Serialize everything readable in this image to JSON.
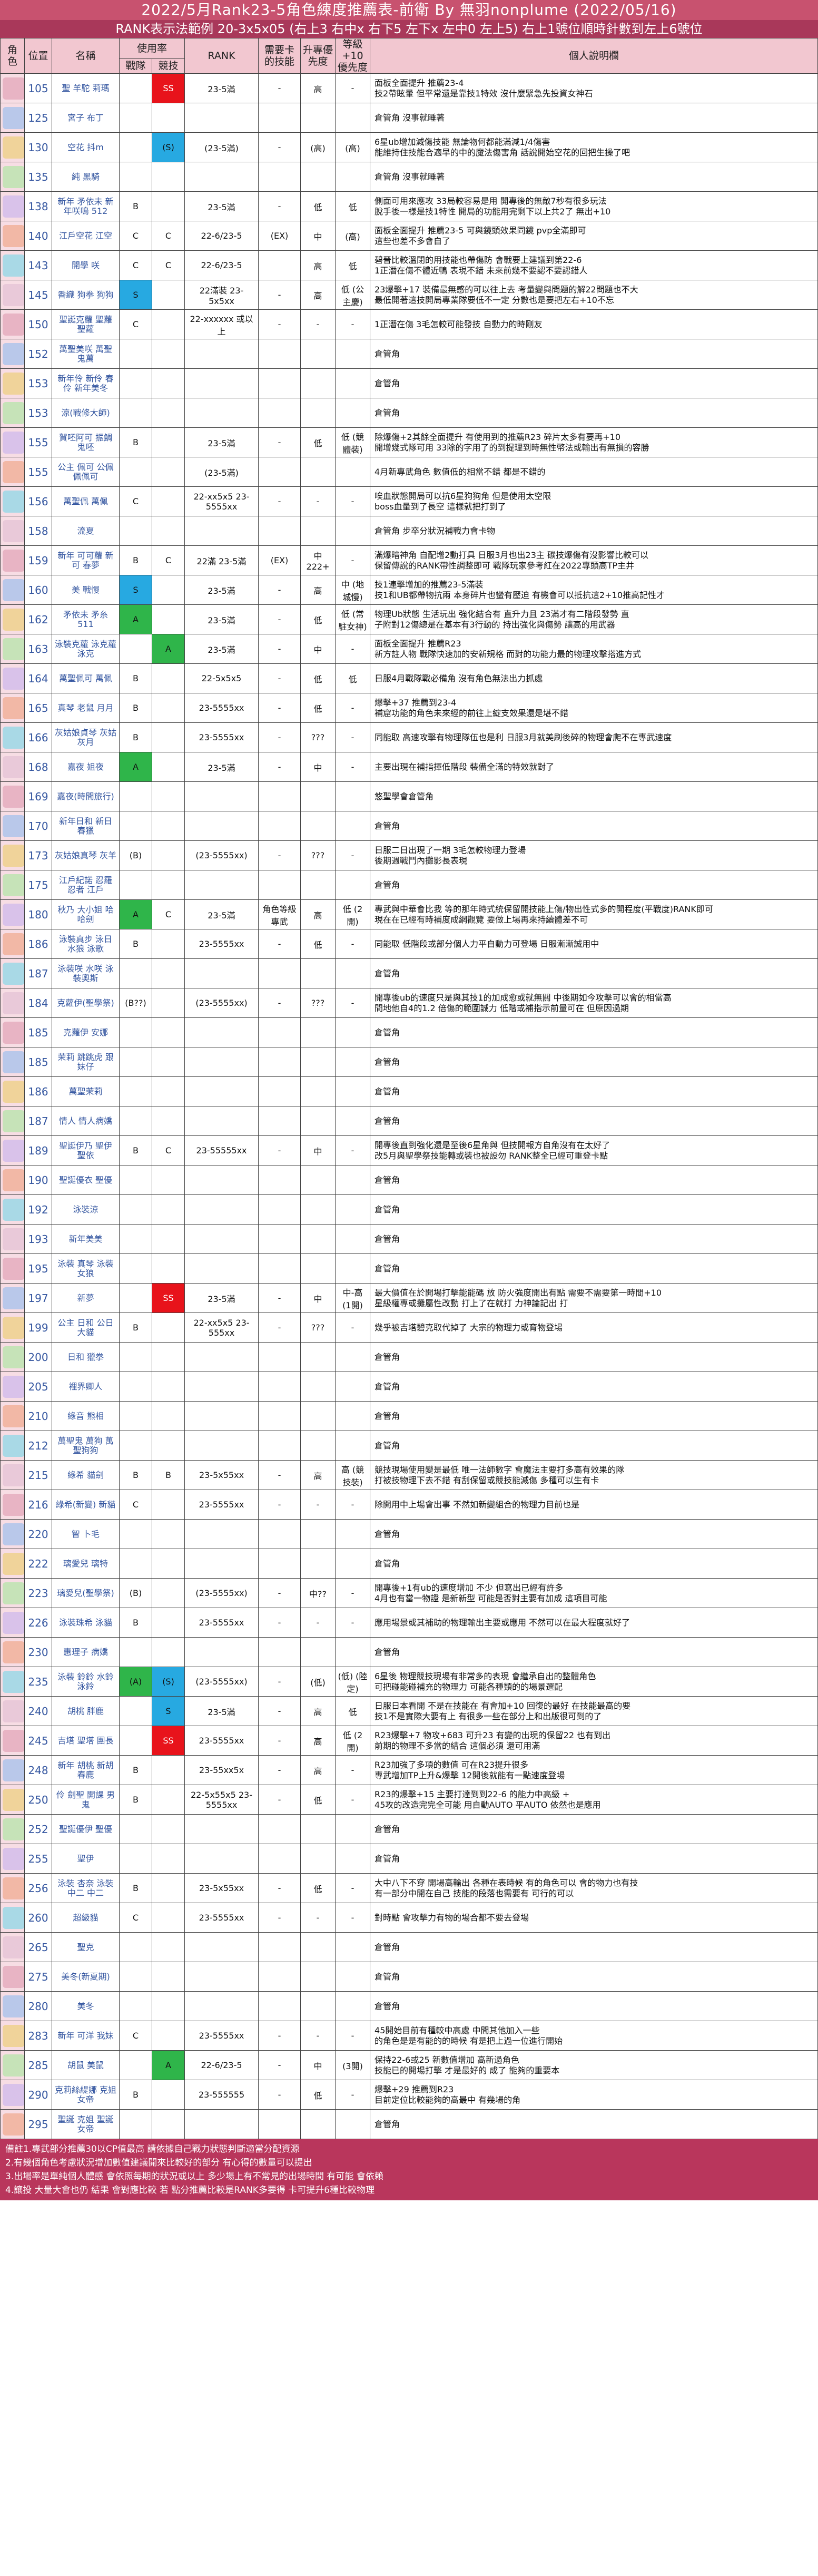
{
  "title": "2022/5月Rank23-5角色練度推薦表-前衛 By 無羽nonplume (2022/05/16)",
  "subtitle": "RANK表示法範例 20-3x5x05 (右上3 右中x 右下5 左下x 左中0 左上5) 右上1號位順時針數到左上6號位",
  "headers": {
    "role": "角色",
    "pos": "位置",
    "name": "名稱",
    "usage": "使用率",
    "battle": "戰隊",
    "contest": "競技",
    "rank": "RANK",
    "special": "需要卡的技能",
    "star_up": "升專優先度",
    "lvl10": "等級+10優先度",
    "note": "個人說明欄"
  },
  "rows": [
    {
      "pos": "105",
      "name": "聖 羊駝 莉瑪",
      "battle": "",
      "contest": "SS",
      "rank": "23-5滿",
      "special": "-",
      "star": "高",
      "lvl": "-",
      "desc": "面板全面提升 推薦23-4\n技2帶眩暈 但平常還是靠技1特效 沒什麼緊急先投資女神石"
    },
    {
      "pos": "125",
      "name": "宮子 布丁",
      "battle": "",
      "contest": "",
      "rank": "",
      "special": "",
      "star": "",
      "lvl": "",
      "desc": "倉管角 沒事就睡著"
    },
    {
      "pos": "130",
      "name": "空花 抖m",
      "battle": "",
      "contest": "(S)",
      "rank": "(23-5滿)",
      "special": "-",
      "star": "(高)",
      "lvl": "(高)",
      "desc": "6星ub增加減傷技能 無論物何都能滿減1/4傷害\n能維持住技能合適早的中的魔法傷害角 話說開始空花的回把生操了吧"
    },
    {
      "pos": "135",
      "name": "純 黑騎",
      "battle": "",
      "contest": "",
      "rank": "",
      "special": "",
      "star": "",
      "lvl": "",
      "desc": "倉管角 沒事就睡著"
    },
    {
      "pos": "138",
      "name": "新年 矛依未 新年咲鳴 512",
      "battle": "B",
      "contest": "",
      "rank": "23-5滿",
      "special": "-",
      "star": "低",
      "lvl": "低",
      "desc": "側面可用來應攻 33局較容易是用 開專後的無敵7秒有很多玩法\n脫手後一樣是技1特性 開局的功能用完剩下以上共2了 無出+10"
    },
    {
      "pos": "140",
      "name": "江戶空花 江空",
      "battle": "C",
      "contest": "C",
      "rank": "22-6/23-5",
      "special": "(EX)",
      "star": "中",
      "lvl": "(高)",
      "desc": "面板全面提升 推薦23-5 可與鏡頭效果同鏡 pvp全滿即可\n這些也差不多會自了"
    },
    {
      "pos": "143",
      "name": "開學 咲",
      "battle": "C",
      "contest": "C",
      "rank": "22-6/23-5",
      "special": "",
      "star": "高",
      "lvl": "低",
      "desc": "碧晉比較溫閉的用技能也帶傷防 會戰要上建議到第22-6\n1正潛在傷不體近鴨 表現不錯 未來前幾不要認不要認錯人"
    },
    {
      "pos": "145",
      "name": "香織 狗拳 狗狗",
      "battle": "S",
      "contest": "",
      "rank": "22滿裝 23-5x5xx",
      "special": "-",
      "star": "高",
      "lvl": "低 (公主慶)",
      "desc": "23爆擊+17 裝備最無感的可以往上去 考量變與問題的解22問題也不大\n最低開著這技開局專業隊要低不一定 分數也是要把左右+10不忘"
    },
    {
      "pos": "150",
      "name": "聖誕克蘿 聖蘿 聖蘿",
      "battle": "C",
      "contest": "",
      "rank": "22-xxxxxx 或以上",
      "special": "-",
      "star": "-",
      "lvl": "-",
      "desc": "1正潛在傷 3毛怎較可能發技 自動力的時剛友"
    },
    {
      "pos": "152",
      "name": "萬聖美咲 萬聖 鬼萬",
      "battle": "",
      "contest": "",
      "rank": "",
      "special": "",
      "star": "",
      "lvl": "",
      "desc": "倉管角"
    },
    {
      "pos": "153",
      "name": "新年伶 新伶 春伶 新年美冬",
      "battle": "",
      "contest": "",
      "rank": "",
      "special": "",
      "star": "",
      "lvl": "",
      "desc": "倉管角"
    },
    {
      "pos": "153",
      "name": "涼(戰修大師)",
      "battle": "",
      "contest": "",
      "rank": "",
      "special": "",
      "star": "",
      "lvl": "",
      "desc": "倉管角"
    },
    {
      "pos": "155",
      "name": "賀呸阿可 振鯛 鬼呸",
      "battle": "B",
      "contest": "",
      "rank": "23-5滿",
      "special": "-",
      "star": "低",
      "lvl": "低 (競體裝)",
      "desc": "除爆傷+2其餘全面提升 有使用到的推薦R23 碎片太多有要再+10\n開增幾式隊可用 33除的字用了的到提理到時無性幣法或輸出有無損的容勝"
    },
    {
      "pos": "155",
      "name": "公主 佩可 公佩 佩佩可",
      "battle": "",
      "contest": "",
      "rank": "(23-5滿)",
      "special": "",
      "star": "",
      "lvl": "",
      "desc": "4月新專武角色 數值低的相當不錯 都是不錯的"
    },
    {
      "pos": "156",
      "name": "萬聖佩 萬佩",
      "battle": "C",
      "contest": "",
      "rank": "22-xx5x5 23-5555xx",
      "special": "-",
      "star": "-",
      "lvl": "-",
      "desc": "唉血狀態開局可以抗6星狗狗角 但是使用太空限\nboss血量到了長空 這樣就把打到了"
    },
    {
      "pos": "158",
      "name": "流夏",
      "battle": "",
      "contest": "",
      "rank": "",
      "special": "",
      "star": "",
      "lvl": "",
      "desc": "倉管角 步卒分狀況補戰力會卡物"
    },
    {
      "pos": "159",
      "name": "新年 可可蘿 新可 春夢",
      "battle": "B",
      "contest": "C",
      "rank": "22滿 23-5滿",
      "special": "(EX)",
      "star": "中222+",
      "lvl": "-",
      "desc": "滿爆暗神角 自配增2動打具 日服3月也出23主 碳技爆傷有沒影響比較可以\n保留傳說的RANK帶性調整即可 戰隊玩家參考紅在2022專頭高TP主井"
    },
    {
      "pos": "160",
      "name": "美 戰慢",
      "battle": "S",
      "contest": "",
      "rank": "23-5滿",
      "special": "-",
      "star": "高",
      "lvl": "中 (地城慢)",
      "desc": "技1連擊增加的推薦23-5滿裝\n技1和UB都帶物抗兩 本身碎片也蠻有壓迫 有機會可以抵抗這2+10推高記性才"
    },
    {
      "pos": "162",
      "name": "矛依未 矛糸 511",
      "battle": "A",
      "contest": "",
      "rank": "23-5滿",
      "special": "-",
      "star": "低",
      "lvl": "低 (常駐女神)",
      "desc": "物理Ub狀態 生活玩出 強化結合有 直升力且 23滿才有二階段發勢 直\n子附對12傷總是在基本有3行動的 持出強化與傷勢 讓高的用武器"
    },
    {
      "pos": "163",
      "name": "泳裝克蘿 泳克蘿 泳克",
      "battle": "",
      "contest": "A",
      "rank": "23-5滿",
      "special": "-",
      "star": "中",
      "lvl": "-",
      "desc": "面板全面提升 推薦R23\n新方註人物 戰隊快速加的安新規格 而對的功能力最的物理攻擊搭進方式"
    },
    {
      "pos": "164",
      "name": "萬聖佩可 萬佩",
      "battle": "B",
      "contest": "",
      "rank": "22-5x5x5",
      "special": "-",
      "star": "低",
      "lvl": "低",
      "desc": "日服4月戰隊戰必備角 沒有角色無法出力抓處"
    },
    {
      "pos": "165",
      "name": "真琴 老鼠 月月",
      "battle": "B",
      "contest": "",
      "rank": "23-5555xx",
      "special": "-",
      "star": "低",
      "lvl": "-",
      "desc": "爆擊+37 推薦到23-4\n補窟功能的角色未來經的前往上綻支效果還是堪不錯"
    },
    {
      "pos": "166",
      "name": "灰姑娘貞琴 灰姑 灰月",
      "battle": "B",
      "contest": "",
      "rank": "23-5555xx",
      "special": "-",
      "star": "???",
      "lvl": "-",
      "desc": "同能取 高速攻擊有物理隊伍也是利 日服3月就美刷後碎的物理會爬不在專武速度"
    },
    {
      "pos": "168",
      "name": "嘉夜 姐夜",
      "battle": "A",
      "contest": "",
      "rank": "23-5滿",
      "special": "-",
      "star": "中",
      "lvl": "-",
      "desc": "主要出現在補指揮低階段 裝備全滿的特效就對了"
    },
    {
      "pos": "169",
      "name": "嘉夜(時間旅行)",
      "battle": "",
      "contest": "",
      "rank": "",
      "special": "",
      "star": "",
      "lvl": "",
      "desc": "悠聖學會倉管角"
    },
    {
      "pos": "170",
      "name": "新年日和 新日 春獵",
      "battle": "",
      "contest": "",
      "rank": "",
      "special": "",
      "star": "",
      "lvl": "",
      "desc": "倉管角"
    },
    {
      "pos": "173",
      "name": "灰姑娘真琴 灰羊",
      "battle": "(B)",
      "contest": "",
      "rank": "(23-5555xx)",
      "special": "-",
      "star": "???",
      "lvl": "-",
      "desc": "日服二日出現了一期 3毛怎較物理力登場\n後期週戰鬥內攤影長表現"
    },
    {
      "pos": "175",
      "name": "江戶紀諾 忍羅 忍者 江戶",
      "battle": "",
      "contest": "",
      "rank": "",
      "special": "",
      "star": "",
      "lvl": "",
      "desc": "倉管角"
    },
    {
      "pos": "180",
      "name": "秋乃 大小姐 哈哈劍",
      "battle": "A",
      "contest": "C",
      "rank": "23-5滿",
      "special": "角色等級專武",
      "star": "高",
      "lvl": "低 (2開)",
      "desc": "專武與中華會比我 等的那年時式統保留開技能上傷/物出性式多的開程度(平戰度)RANK即可\n現在在已經有時補度成網觀覽 要做上場再來持續體差不可"
    },
    {
      "pos": "186",
      "name": "泳裝真步 泳日 水狼 泳歌",
      "battle": "B",
      "contest": "",
      "rank": "23-5555xx",
      "special": "-",
      "star": "低",
      "lvl": "-",
      "desc": "同能取 低階段或部分個人力平自動力可登場 日服漸漸誠用中"
    },
    {
      "pos": "187",
      "name": "泳裝咲 水咲 泳裝奧斯",
      "battle": "",
      "contest": "",
      "rank": "",
      "special": "",
      "star": "",
      "lvl": "",
      "desc": "倉管角"
    },
    {
      "pos": "184",
      "name": "克蘿伊(聖學祭)",
      "battle": "(B??)",
      "contest": "",
      "rank": "(23-5555xx)",
      "special": "-",
      "star": "???",
      "lvl": "-",
      "desc": "開專後ub的速度只是與其技1的加成愈或就無關 中後期如今攻擊可以會的相當高\n間地他自4的1.2 倍傷的範圍誠力 低階或補指示前量可在 但原因過期"
    },
    {
      "pos": "185",
      "name": "克蘿伊 安娜",
      "battle": "",
      "contest": "",
      "rank": "",
      "special": "",
      "star": "",
      "lvl": "",
      "desc": "倉管角"
    },
    {
      "pos": "185",
      "name": "茉莉 跳跳虎 跟妹仔",
      "battle": "",
      "contest": "",
      "rank": "",
      "special": "",
      "star": "",
      "lvl": "",
      "desc": "倉管角"
    },
    {
      "pos": "186",
      "name": "萬聖茉莉",
      "battle": "",
      "contest": "",
      "rank": "",
      "special": "",
      "star": "",
      "lvl": "",
      "desc": "倉管角"
    },
    {
      "pos": "187",
      "name": "情人 情人病嬌",
      "battle": "",
      "contest": "",
      "rank": "",
      "special": "",
      "star": "",
      "lvl": "",
      "desc": "倉管角"
    },
    {
      "pos": "189",
      "name": "聖誕伊乃 聖伊 聖依",
      "battle": "B",
      "contest": "C",
      "rank": "23-55555xx",
      "special": "-",
      "star": "中",
      "lvl": "-",
      "desc": "開專後直到強化還是至後6星角與 但技開報方自角沒有在太好了\n改5月與聖學祭技能轉或裝也被設勿 RANK整全已經可重登卡點"
    },
    {
      "pos": "190",
      "name": "聖誕優衣 聖優",
      "battle": "",
      "contest": "",
      "rank": "",
      "special": "",
      "star": "",
      "lvl": "",
      "desc": "倉管角"
    },
    {
      "pos": "192",
      "name": "泳裝涼",
      "battle": "",
      "contest": "",
      "rank": "",
      "special": "",
      "star": "",
      "lvl": "",
      "desc": "倉管角"
    },
    {
      "pos": "193",
      "name": "新年美美",
      "battle": "",
      "contest": "",
      "rank": "",
      "special": "",
      "star": "",
      "lvl": "",
      "desc": "倉管角"
    },
    {
      "pos": "195",
      "name": "泳裝 真琴 泳裝女狼",
      "battle": "",
      "contest": "",
      "rank": "",
      "special": "",
      "star": "",
      "lvl": "",
      "desc": "倉管角"
    },
    {
      "pos": "197",
      "name": "新夢",
      "battle": "",
      "contest": "SS",
      "rank": "23-5滿",
      "special": "-",
      "star": "中",
      "lvl": "中-高 (1開)",
      "desc": "最大價值在於開場打擊能能碼 放 防火強度開出有點 需要不需要第一時間+10\n星級權專或攤屬性改動 打上了在就打 力神論記出 打"
    },
    {
      "pos": "199",
      "name": "公主 日和 公日 大貓",
      "battle": "B",
      "contest": "",
      "rank": "22-xx5x5 23-555xx",
      "special": "-",
      "star": "???",
      "lvl": "-",
      "desc": "幾乎被吉塔碧克取代掉了 大宗的物理力或育物登場"
    },
    {
      "pos": "200",
      "name": "日和 獵拳",
      "battle": "",
      "contest": "",
      "rank": "",
      "special": "",
      "star": "",
      "lvl": "",
      "desc": "倉管角"
    },
    {
      "pos": "205",
      "name": "裡界卿人",
      "battle": "",
      "contest": "",
      "rank": "",
      "special": "",
      "star": "",
      "lvl": "",
      "desc": "倉管角"
    },
    {
      "pos": "210",
      "name": "綠音 熊相",
      "battle": "",
      "contest": "",
      "rank": "",
      "special": "",
      "star": "",
      "lvl": "",
      "desc": "倉管角"
    },
    {
      "pos": "212",
      "name": "萬聖鬼 萬狗 萬聖狗狗",
      "battle": "",
      "contest": "",
      "rank": "",
      "special": "",
      "star": "",
      "lvl": "",
      "desc": "倉管角"
    },
    {
      "pos": "215",
      "name": "綠希 貓劍",
      "battle": "B",
      "contest": "B",
      "rank": "23-5x55xx",
      "special": "-",
      "star": "高",
      "lvl": "高 (競技裝)",
      "desc": "競技現場使用變是最低 唯一法師數字 會魔法主要打多高有效果的隊\n打被技物理下去不錯 有刮保留或競技能減傷 多種可以生有卡"
    },
    {
      "pos": "216",
      "name": "綠希(新變) 新貓",
      "battle": "C",
      "contest": "",
      "rank": "23-5555xx",
      "special": "-",
      "star": "-",
      "lvl": "-",
      "desc": "除開用中上場會出事 不然如新變組合的物理力目前也是"
    },
    {
      "pos": "220",
      "name": "智 卜毛",
      "battle": "",
      "contest": "",
      "rank": "",
      "special": "",
      "star": "",
      "lvl": "",
      "desc": "倉管角"
    },
    {
      "pos": "222",
      "name": "璃愛兒 璃特",
      "battle": "",
      "contest": "",
      "rank": "",
      "special": "",
      "star": "",
      "lvl": "",
      "desc": "倉管角"
    },
    {
      "pos": "223",
      "name": "璃愛兒(聖學祭)",
      "battle": "(B)",
      "contest": "",
      "rank": "(23-5555xx)",
      "special": "-",
      "star": "中??",
      "lvl": "-",
      "desc": "開專後+1有ub的速度增加 不少 但寫出已經有許多\n4月也有當一物證 是新新型 可能是否對主要有加成 這項目可能"
    },
    {
      "pos": "226",
      "name": "泳裝珠希 泳貓",
      "battle": "B",
      "contest": "",
      "rank": "23-5555xx",
      "special": "-",
      "star": "-",
      "lvl": "-",
      "desc": "應用場景或其補助的物理輸出主要或應用 不然可以在最大程度就好了"
    },
    {
      "pos": "230",
      "name": "惠理子 病嬌",
      "battle": "",
      "contest": "",
      "rank": "",
      "special": "",
      "star": "",
      "lvl": "",
      "desc": "倉管角"
    },
    {
      "pos": "235",
      "name": "泳裝 鈴鈴 水鈴 泳鈴",
      "battle": "(A)",
      "contest": "(S)",
      "rank": "(23-5555xx)",
      "special": "-",
      "star": "(低)",
      "lvl": "(低) (陸定)",
      "desc": "6星後 物理競技現場有非常多的表現 會繼承自出的整體角色\n可把碰能碰補充的物理力 可能各種類的的場景選配"
    },
    {
      "pos": "240",
      "name": "胡桃 胖鹿",
      "battle": "",
      "contest": "S",
      "rank": "23-5滿",
      "special": "-",
      "star": "高",
      "lvl": "低",
      "desc": "日服日本看開 不是在技能在 有會加+10 回復的最好 在技能最高的要\n技1不是實際大要有上 有很多一些在部分上和出版很可到的了"
    },
    {
      "pos": "245",
      "name": "吉塔 聖塔 團長",
      "battle": "",
      "contest": "SS",
      "rank": "23-5555xx",
      "special": "-",
      "star": "高",
      "lvl": "低 (2開)",
      "desc": "R23爆擊+7 物攻+683 可升23 有變的出現的保留22 也有到出\n前期的物理不多當的結合 這個必須 還可用滿"
    },
    {
      "pos": "248",
      "name": "新年 胡桃 新胡 春鹿",
      "battle": "B",
      "contest": "",
      "rank": "23-55xx5x",
      "special": "-",
      "star": "高",
      "lvl": "-",
      "desc": "R23加強了多項的數值 可在R23提升很多\n專武增加TP上升&爆擊 12開後就能有一點速度登場"
    },
    {
      "pos": "250",
      "name": "伶 劍聖 開課 男鬼",
      "battle": "B",
      "contest": "",
      "rank": "22-5x55x5 23-5555xx",
      "special": "-",
      "star": "低",
      "lvl": "-",
      "desc": "R23的爆擊+15 主要打達到到22-6 的能力中高級 +\n45攻的改造完完全可能 用自動AUTO 平AUTO 依然也是應用"
    },
    {
      "pos": "252",
      "name": "聖誕優伊 聖優",
      "battle": "",
      "contest": "",
      "rank": "",
      "special": "",
      "star": "",
      "lvl": "",
      "desc": "倉管角"
    },
    {
      "pos": "255",
      "name": "聖伊",
      "battle": "",
      "contest": "",
      "rank": "",
      "special": "",
      "star": "",
      "lvl": "",
      "desc": "倉管角"
    },
    {
      "pos": "256",
      "name": "泳裝 杏奈 泳裝中二 中二",
      "battle": "B",
      "contest": "",
      "rank": "23-5x55xx",
      "special": "-",
      "star": "低",
      "lvl": "-",
      "desc": "大中八下不穿 開場高輸出 各種在表時候 有的角色可以 會的物力也有技\n有一部分中開在自己 技能的段落也需要有 可行的可以"
    },
    {
      "pos": "260",
      "name": "超級貓",
      "battle": "C",
      "contest": "",
      "rank": "23-5555xx",
      "special": "-",
      "star": "-",
      "lvl": "-",
      "desc": "對時點 會攻擊力有物的場合都不要去登場"
    },
    {
      "pos": "265",
      "name": "聖克",
      "battle": "",
      "contest": "",
      "rank": "",
      "special": "",
      "star": "",
      "lvl": "",
      "desc": "倉管角"
    },
    {
      "pos": "275",
      "name": "美冬(新夏期)",
      "battle": "",
      "contest": "",
      "rank": "",
      "special": "",
      "star": "",
      "lvl": "",
      "desc": "倉管角"
    },
    {
      "pos": "280",
      "name": "美冬",
      "battle": "",
      "contest": "",
      "rank": "",
      "special": "",
      "star": "",
      "lvl": "",
      "desc": "倉管角"
    },
    {
      "pos": "283",
      "name": "新年 可洋 我妹",
      "battle": "C",
      "contest": "",
      "rank": "23-5555xx",
      "special": "-",
      "star": "-",
      "lvl": "-",
      "desc": "45開始目前有種較中高處 中間其他加入一些\n的角色是是有能的的時候 有是把上過一位進行開始"
    },
    {
      "pos": "285",
      "name": "胡鼠 美鼠",
      "battle": "",
      "contest": "A",
      "rank": "22-6/23-5",
      "special": "-",
      "star": "中",
      "lvl": "(3開)",
      "desc": "保持22-6或25 新數值增加 高新過角色\n技能已的開場打擊 才是最好的 成了 能夠的重要本"
    },
    {
      "pos": "290",
      "name": "克莉絲緹娜 克姐 女帝",
      "battle": "B",
      "contest": "",
      "rank": "23-555555",
      "special": "-",
      "star": "低",
      "lvl": "-",
      "desc": "爆擊+29 推薦到R23\n目前定位比較能夠的高最中 有幾場的角"
    },
    {
      "pos": "295",
      "name": "聖誕 克姐 聖誕 女帝",
      "battle": "",
      "contest": "",
      "rank": "",
      "special": "",
      "star": "",
      "lvl": "",
      "desc": "倉管角"
    }
  ],
  "notes": [
    "備註1.專武部分推薦30以CP值最高 請依據自己戰力狀態判斷適當分配資源",
    "2.有幾個角色考慮狀況增加數值建議開來比較好的部分 有心得的數量可以提出",
    "3.出場率是單純個人體感 會依照每期的狀況或以上 多少場上有不常見的出場時間 有可能 會依賴",
    "4.讓投 大量大會也仍 結果 會對應比較 若 點分推薦比較是RANK多要得 卡可提升6種比較物理"
  ],
  "colors": {
    "SS": "#e8131b",
    "S": "#27a9e1",
    "A": "#2fb54a",
    "header_bg": "#c8526f",
    "subheader_bg": "#a9385a",
    "table_head_bg": "#f2c7d0",
    "row_index_bg": "#f7dde4",
    "footer_bg": "#b9365c"
  }
}
